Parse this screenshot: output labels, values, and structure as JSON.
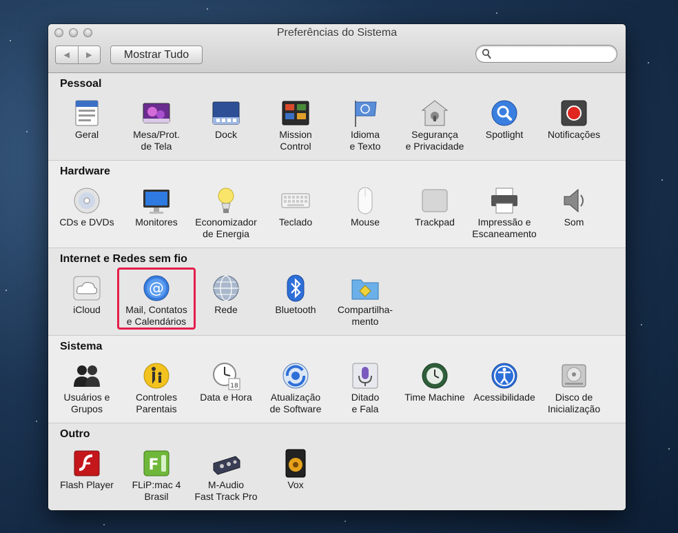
{
  "window": {
    "title": "Preferências do Sistema",
    "back_label": "◀",
    "forward_label": "▶",
    "show_all_label": "Mostrar Tudo",
    "search_value": ""
  },
  "sections": [
    {
      "title": "Pessoal",
      "items": [
        {
          "label": "Geral",
          "icon": "general-icon"
        },
        {
          "label": "Mesa/Prot.\nde Tela",
          "icon": "desktop-screensaver-icon"
        },
        {
          "label": "Dock",
          "icon": "dock-icon"
        },
        {
          "label": "Mission\nControl",
          "icon": "mission-control-icon"
        },
        {
          "label": "Idioma\ne Texto",
          "icon": "language-text-icon"
        },
        {
          "label": "Segurança\ne Privacidade",
          "icon": "security-privacy-icon"
        },
        {
          "label": "Spotlight",
          "icon": "spotlight-icon"
        },
        {
          "label": "Notificações",
          "icon": "notifications-icon"
        }
      ]
    },
    {
      "title": "Hardware",
      "items": [
        {
          "label": "CDs e DVDs",
          "icon": "cd-dvd-icon"
        },
        {
          "label": "Monitores",
          "icon": "monitor-icon"
        },
        {
          "label": "Economizador\nde Energia",
          "icon": "energy-saver-icon"
        },
        {
          "label": "Teclado",
          "icon": "keyboard-icon"
        },
        {
          "label": "Mouse",
          "icon": "mouse-icon"
        },
        {
          "label": "Trackpad",
          "icon": "trackpad-icon"
        },
        {
          "label": "Impressão e\nEscaneamento",
          "icon": "printer-icon"
        },
        {
          "label": "Som",
          "icon": "speaker-icon"
        }
      ]
    },
    {
      "title": "Internet e Redes sem fio",
      "items": [
        {
          "label": "iCloud",
          "icon": "icloud-icon"
        },
        {
          "label": "Mail, Contatos\ne Calendários",
          "icon": "mail-at-icon"
        },
        {
          "label": "Rede",
          "icon": "network-globe-icon"
        },
        {
          "label": "Bluetooth",
          "icon": "bluetooth-icon"
        },
        {
          "label": "Compartilha-\nmento",
          "icon": "sharing-folder-icon"
        }
      ]
    },
    {
      "title": "Sistema",
      "items": [
        {
          "label": "Usuários e\nGrupos",
          "icon": "users-groups-icon"
        },
        {
          "label": "Controles\nParentais",
          "icon": "parental-controls-icon"
        },
        {
          "label": "Data e Hora",
          "icon": "clock-calendar-icon"
        },
        {
          "label": "Atualização\nde Software",
          "icon": "software-update-icon"
        },
        {
          "label": "Ditado\ne Fala",
          "icon": "microphone-icon"
        },
        {
          "label": "Time Machine",
          "icon": "time-machine-icon"
        },
        {
          "label": "Acessibilidade",
          "icon": "accessibility-icon"
        },
        {
          "label": "Disco de\nInicialização",
          "icon": "startup-disk-icon"
        }
      ]
    },
    {
      "title": "Outro",
      "items": [
        {
          "label": "Flash Player",
          "icon": "flash-player-icon"
        },
        {
          "label": "FLiP:mac 4 Brasil",
          "icon": "flip-mac-icon"
        },
        {
          "label": "M-Audio\nFast Track Pro",
          "icon": "m-audio-icon"
        },
        {
          "label": "Vox",
          "icon": "vox-speaker-icon"
        }
      ]
    }
  ],
  "colors": {
    "highlight_box": "#e51d4a",
    "window_bg": "#ececec"
  }
}
